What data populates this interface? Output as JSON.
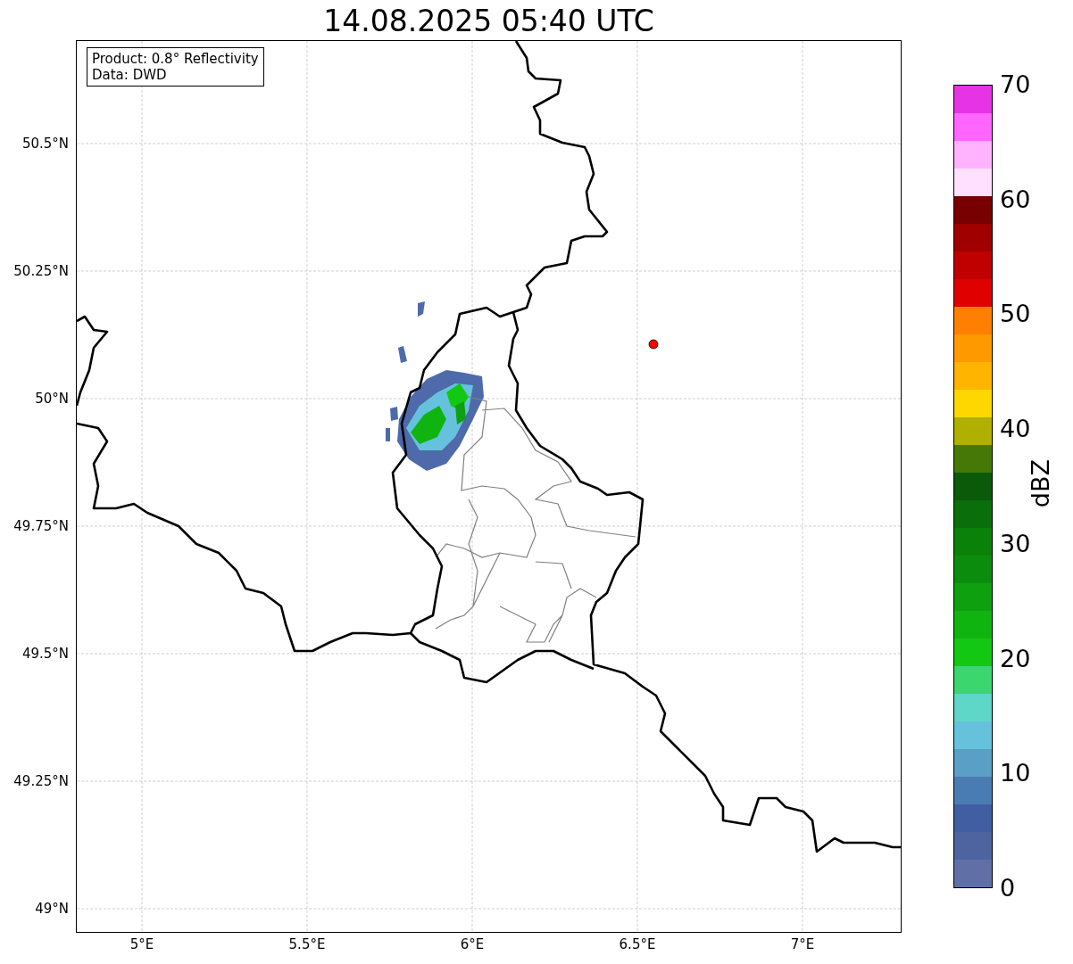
{
  "title": "14.08.2025 05:40 UTC",
  "info_box": [
    "Product: 0.8° Reflectivity",
    "Data: DWD"
  ],
  "y_ticks": [
    "50.5°N",
    "50.25°N",
    "50°N",
    "49.75°N",
    "49.5°N",
    "49.25°N",
    "49°N"
  ],
  "x_ticks": [
    "5°E",
    "5.5°E",
    "6°E",
    "6.5°E",
    "7°E"
  ],
  "colorbar": {
    "label": "dBZ",
    "ticks": [
      "70",
      "60",
      "50",
      "40",
      "30",
      "20",
      "10",
      "0"
    ],
    "segments": [
      {
        "color": "#e633e6"
      },
      {
        "color": "#ff66ff"
      },
      {
        "color": "#ffb3ff"
      },
      {
        "color": "#ffe0ff"
      },
      {
        "color": "#780000"
      },
      {
        "color": "#a00000"
      },
      {
        "color": "#c00000"
      },
      {
        "color": "#e00000"
      },
      {
        "color": "#ff7f00"
      },
      {
        "color": "#ff9900"
      },
      {
        "color": "#ffb400"
      },
      {
        "color": "#ffd700"
      },
      {
        "color": "#b0b000"
      },
      {
        "color": "#467808"
      },
      {
        "color": "#0a5a0a"
      },
      {
        "color": "#0a6e0a"
      },
      {
        "color": "#0a820a"
      },
      {
        "color": "#0c8c0c"
      },
      {
        "color": "#0ea00e"
      },
      {
        "color": "#10b410"
      },
      {
        "color": "#12c812"
      },
      {
        "color": "#3cd66e"
      },
      {
        "color": "#5ed6c8"
      },
      {
        "color": "#66c2dc"
      },
      {
        "color": "#5a9fc6"
      },
      {
        "color": "#4a7cb4"
      },
      {
        "color": "#425ea2"
      },
      {
        "color": "#4e64a0"
      },
      {
        "color": "#6070a6"
      }
    ]
  }
}
